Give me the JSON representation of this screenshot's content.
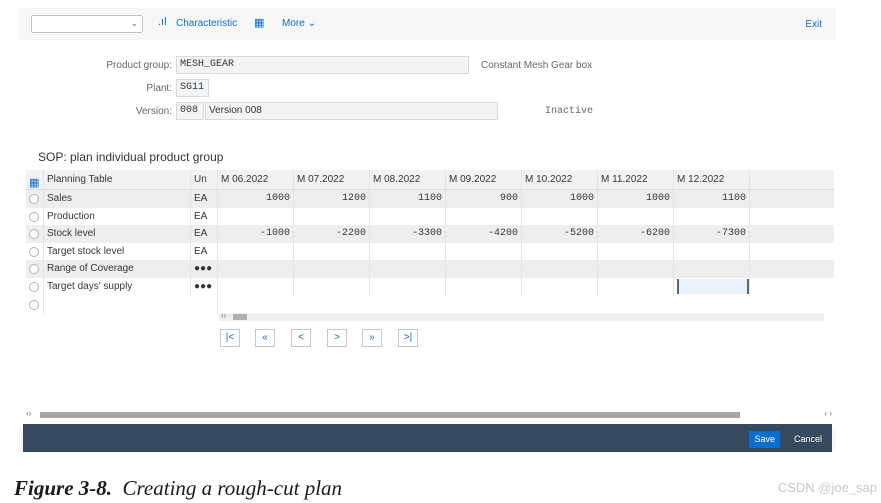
{
  "toolbar": {
    "dropdown_value": "",
    "characteristic_label": "Characteristic",
    "more_label": "More",
    "exit_label": "Exit"
  },
  "header": {
    "product_group_label": "Product group:",
    "product_group_value": "MESH_GEAR",
    "product_group_desc": "Constant Mesh Gear box",
    "plant_label": "Plant:",
    "plant_value": "SG11",
    "version_label": "Version:",
    "version_value": "008",
    "version_text": "Version 008",
    "status": "Inactive"
  },
  "section_title": "SOP: plan individual product group",
  "table": {
    "col_planning": "Planning Table",
    "col_unit": "Un",
    "months": [
      "M 06.2022",
      "M 07.2022",
      "M 08.2022",
      "M 09.2022",
      "M 10.2022",
      "M 11.2022",
      "M 12.2022"
    ],
    "rows": [
      {
        "label": "Sales",
        "unit": "EA",
        "values": [
          "1000",
          "1200",
          "1100",
          "900",
          "1000",
          "1000",
          "1100"
        ]
      },
      {
        "label": "Production",
        "unit": "EA",
        "values": [
          "",
          "",
          "",
          "",
          "",
          "",
          ""
        ]
      },
      {
        "label": "Stock level",
        "unit": "EA",
        "values": [
          "-1000",
          "-2200",
          "-3300",
          "-4200",
          "-5200",
          "-6200",
          "-7300"
        ]
      },
      {
        "label": "Target stock level",
        "unit": "EA",
        "values": [
          "",
          "",
          "",
          "",
          "",
          "",
          ""
        ]
      },
      {
        "label": "Range of Coverage",
        "unit": "●●●",
        "values": [
          "",
          "",
          "",
          "",
          "",
          "",
          ""
        ]
      },
      {
        "label": "Target days' supply",
        "unit": "●●●",
        "values": [
          "",
          "",
          "",
          "",
          "",
          "",
          ""
        ]
      }
    ]
  },
  "nav": {
    "first": "|<",
    "prev_page": "«",
    "prev": "<",
    "next": ">",
    "next_page": "»",
    "last": ">|"
  },
  "footer": {
    "save_label": "Save",
    "cancel_label": "Cancel"
  },
  "caption": {
    "figure": "Figure 3-8.",
    "text": "Creating a rough-cut plan"
  },
  "watermark": "CSDN @joe_sap",
  "colors": {
    "accent": "#0a6ed1",
    "footer_bar": "#354a5f"
  }
}
